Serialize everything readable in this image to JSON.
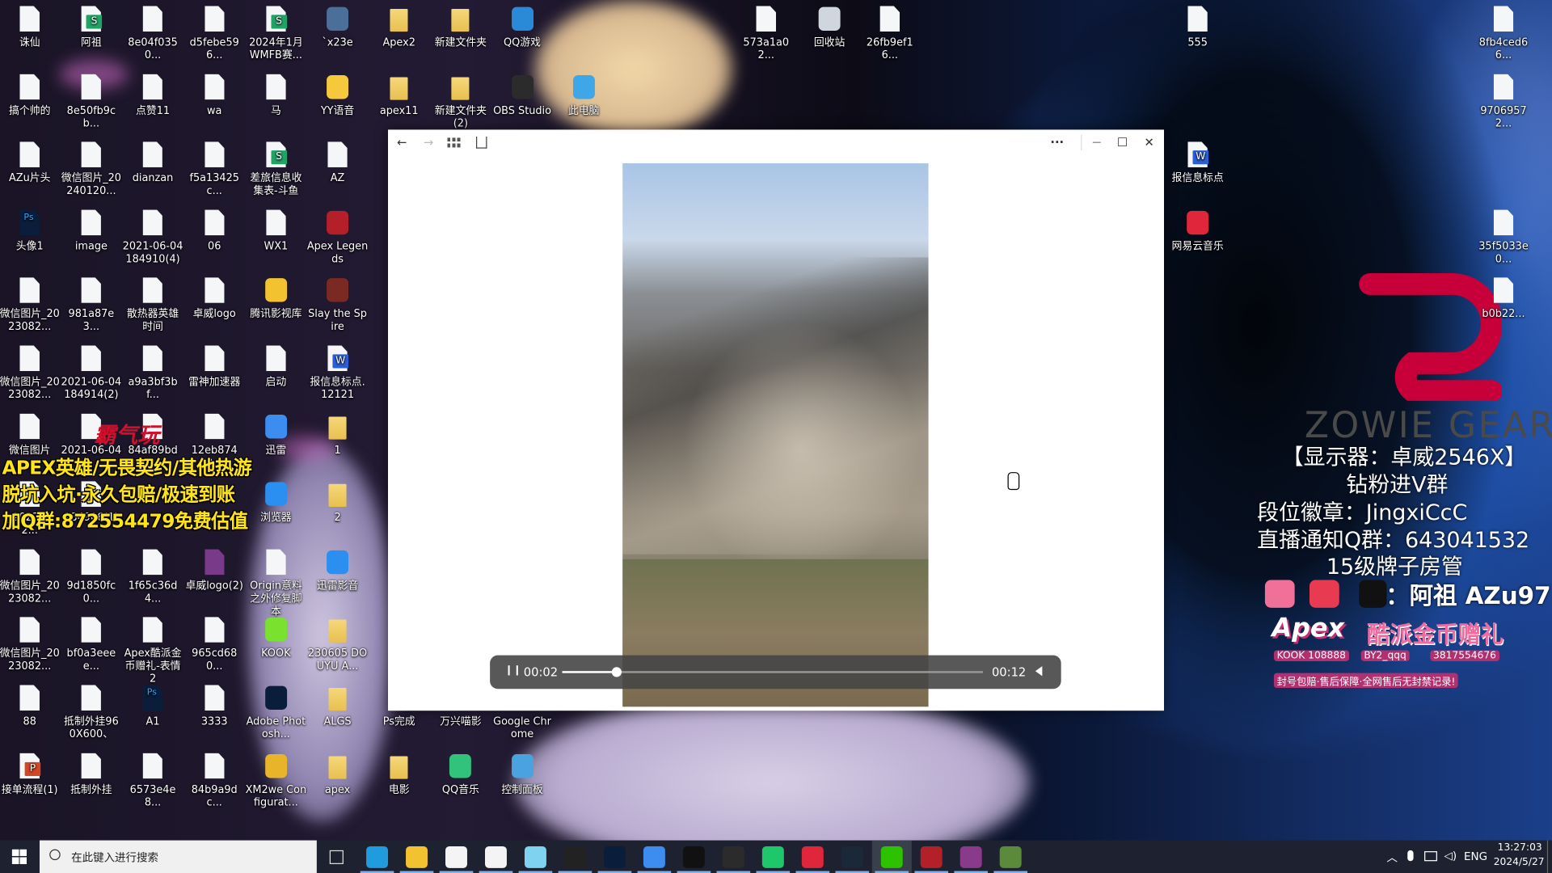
{
  "desktop_icons": [
    {
      "label": "诛仙",
      "icon": "mp4-file-icon",
      "type": "mp4"
    },
    {
      "label": "搞个帅的",
      "icon": "mp4-file-icon",
      "type": "mp4"
    },
    {
      "label": "AZu片头",
      "icon": "mp4-file-icon",
      "type": "mp4"
    },
    {
      "label": "头像1",
      "icon": "psd-file-icon",
      "type": "psd"
    },
    {
      "label": "微信图片_2023082...",
      "icon": "jpg-file-icon",
      "type": "jpg"
    },
    {
      "label": "微信图片_2023082...",
      "icon": "jpg-file-icon",
      "type": "jpg"
    },
    {
      "label": "微信图片",
      "icon": "jpg-file-icon",
      "type": "jpg"
    },
    {
      "label": "_2023082...",
      "icon": "jpg-file-icon",
      "type": "jpg"
    },
    {
      "label": "微信图片_2023082...",
      "icon": "jpg-file-icon",
      "type": "jpg"
    },
    {
      "label": "微信图片_2023082...",
      "icon": "jpg-file-icon",
      "type": "jpg"
    },
    {
      "label": "88",
      "icon": "png-file-icon",
      "type": "png"
    },
    {
      "label": "接单流程(1)",
      "icon": "ppt-file-icon",
      "type": "ppt"
    },
    {
      "label": "阿祖",
      "icon": "spreadsheet-file-icon",
      "type": "xls"
    },
    {
      "label": "8e50fb9cb...",
      "icon": "png-file-icon",
      "type": "png"
    },
    {
      "label": "微信图片_20240120...",
      "icon": "png-file-icon",
      "type": "png"
    },
    {
      "label": "image",
      "icon": "png-file-icon",
      "type": "png"
    },
    {
      "label": "981a87e3...",
      "icon": "png-file-icon",
      "type": "png"
    },
    {
      "label": "2021-06-04 184914(2)",
      "icon": "jpg-file-icon",
      "type": "jpg"
    },
    {
      "label": "2021-06-04",
      "icon": "jpg-file-icon",
      "type": "jpg"
    },
    {
      "label": "184906(1)",
      "icon": "jpg-file-icon",
      "type": "jpg"
    },
    {
      "label": "9d1850fc0...",
      "icon": "png-file-icon",
      "type": "png"
    },
    {
      "label": "bf0a3eeee...",
      "icon": "png-file-icon",
      "type": "png"
    },
    {
      "label": "抵制外挂960X600、",
      "icon": "png-file-icon",
      "type": "png"
    },
    {
      "label": "抵制外挂",
      "icon": "png-file-icon",
      "type": "png"
    },
    {
      "label": "8e04f0350...",
      "icon": "jpg-file-icon",
      "type": "jpg"
    },
    {
      "label": "点赞11",
      "icon": "png-file-icon",
      "type": "png"
    },
    {
      "label": "dianzan",
      "icon": "png-file-icon",
      "type": "png"
    },
    {
      "label": "2021-06-04 184910(4)",
      "icon": "jpg-file-icon",
      "type": "jpg"
    },
    {
      "label": "散热器英雄时间",
      "icon": "png-file-icon",
      "type": "png"
    },
    {
      "label": "a9a3bf3bf...",
      "icon": "jpg-file-icon",
      "type": "jpg"
    },
    {
      "label": "84af89bd2...",
      "icon": "jpg-file-icon",
      "type": "jpg"
    },
    {
      "label": "1f65c36d4...",
      "icon": "png-file-icon",
      "type": "png"
    },
    {
      "label": "Apex酷派金币赠礼-表情2",
      "icon": "gif-file-icon",
      "type": "gif"
    },
    {
      "label": "A1",
      "icon": "psd-file-icon",
      "type": "psd"
    },
    {
      "label": "6573e4e8...",
      "icon": "png-file-icon",
      "type": "png"
    },
    {
      "label": "d5febe596...",
      "icon": "png-file-icon",
      "type": "png"
    },
    {
      "label": "wa",
      "icon": "png-file-icon",
      "type": "png"
    },
    {
      "label": "f5a13425c...",
      "icon": "jpg-file-icon",
      "type": "jpg"
    },
    {
      "label": "06",
      "icon": "gif-file-icon",
      "type": "gif"
    },
    {
      "label": "卓威logo",
      "icon": "png-file-icon",
      "type": "png"
    },
    {
      "label": "雷神加速器",
      "icon": "png-file-icon",
      "type": "png"
    },
    {
      "label": "12eb8740...",
      "icon": "png-file-icon",
      "type": "png"
    },
    {
      "label": "卓威logo(2)",
      "icon": "rar-archive-icon",
      "type": "rar"
    },
    {
      "label": "965cd680...",
      "icon": "png-file-icon",
      "type": "png"
    },
    {
      "label": "3333",
      "icon": "png-file-icon",
      "type": "png"
    },
    {
      "label": "84b9a9dc...",
      "icon": "png-file-icon",
      "type": "png"
    },
    {
      "label": "2024年1月WMFB赛...",
      "icon": "spreadsheet-file-icon",
      "type": "xls"
    },
    {
      "label": "马",
      "icon": "jpeg-file-icon",
      "type": "jpg"
    },
    {
      "label": "差旅信息收集表-斗鱼",
      "icon": "spreadsheet-file-icon",
      "type": "xls"
    },
    {
      "label": "WX1",
      "icon": "png-file-icon",
      "type": "png"
    },
    {
      "label": "腾讯影视库",
      "icon": "tencent-video-library-icon",
      "type": "app",
      "color": "#f2c230"
    },
    {
      "label": "启动",
      "icon": "text-file-icon",
      "type": "txt"
    },
    {
      "label": "迅雷",
      "icon": "xunlei-icon",
      "type": "app",
      "color": "#3d8cf0"
    },
    {
      "label": "浏览器",
      "icon": "browser-icon",
      "type": "app",
      "color": "#2a8ff0"
    },
    {
      "label": "Origin意料之外修复脚本",
      "icon": "script-file-icon",
      "type": "txt"
    },
    {
      "label": "KOOK",
      "icon": "kook-icon",
      "type": "app",
      "color": "#7be12f"
    },
    {
      "label": "Adobe Photosh...",
      "icon": "photoshop-icon",
      "type": "app",
      "color": "#0a1d3a"
    },
    {
      "label": "XM2we Configurat...",
      "icon": "xm2we-config-icon",
      "type": "app",
      "color": "#e8b52a"
    },
    {
      "label": "`x23e",
      "icon": "x23e-app-icon",
      "type": "app",
      "color": "#4c6f9a"
    },
    {
      "label": "YY语音",
      "icon": "yy-voice-icon",
      "type": "app",
      "color": "#f5c93b"
    },
    {
      "label": "AZ",
      "icon": "text-file-icon",
      "type": "txt"
    },
    {
      "label": "Apex Legends",
      "icon": "apex-legends-icon",
      "type": "app",
      "color": "#b3202a"
    },
    {
      "label": "Slay the Spire",
      "icon": "slay-the-spire-icon",
      "type": "app",
      "color": "#7a2a22"
    },
    {
      "label": "报信息标点.12121",
      "icon": "word-file-icon",
      "type": "doc"
    },
    {
      "label": "1",
      "icon": "folder-icon",
      "type": "folder"
    },
    {
      "label": "2",
      "icon": "folder-icon",
      "type": "folder"
    },
    {
      "label": "迅雷影音",
      "icon": "xunlei-player-icon",
      "type": "app",
      "color": "#2a8ff0"
    },
    {
      "label": "230605 DOUYU A...",
      "icon": "folder-icon",
      "type": "folder"
    },
    {
      "label": "ALGS",
      "icon": "folder-icon",
      "type": "folder"
    },
    {
      "label": "apex",
      "icon": "folder-icon",
      "type": "folder"
    },
    {
      "label": "Apex2",
      "icon": "folder-icon",
      "type": "folder"
    },
    {
      "label": "apex11",
      "icon": "folder-icon",
      "type": "folder"
    },
    {
      "label": "Ps完成",
      "icon": "folder-icon",
      "type": "folder"
    },
    {
      "label": "电影",
      "icon": "folder-icon",
      "type": "folder"
    },
    {
      "label": "新建文件夹",
      "icon": "folder-icon",
      "type": "folder"
    },
    {
      "label": "新建文件夹 (2)",
      "icon": "folder-icon",
      "type": "folder"
    },
    {
      "label": "万兴喵影",
      "icon": "wondershare-filmora-icon",
      "type": "app",
      "color": "#1d9ad6"
    },
    {
      "label": "QQ音乐",
      "icon": "qq-music-icon",
      "type": "app",
      "color": "#31c27c"
    },
    {
      "label": "QQ游戏",
      "icon": "qq-game-icon",
      "type": "app",
      "color": "#2b8ad8"
    },
    {
      "label": "OBS Studio",
      "icon": "obs-studio-icon",
      "type": "app",
      "color": "#2b2b2b"
    },
    {
      "label": "Google Chrome",
      "icon": "chrome-icon",
      "type": "app",
      "color": "#dd4b3e"
    },
    {
      "label": "控制面板",
      "icon": "control-panel-icon",
      "type": "app",
      "color": "#4aa3df"
    },
    {
      "label": "此电脑",
      "icon": "this-pc-icon",
      "type": "app",
      "color": "#3fa7e8"
    },
    {
      "label": "573a1a02...",
      "icon": "png-file-icon",
      "type": "png"
    },
    {
      "label": "回收站",
      "icon": "recycle-bin-icon",
      "type": "app",
      "color": "#cfd6de"
    },
    {
      "label": "26fb9ef16...",
      "icon": "png-file-icon",
      "type": "png"
    },
    {
      "label": "555",
      "icon": "png-file-icon",
      "type": "png"
    },
    {
      "label": "报信息标点",
      "icon": "word-file-icon",
      "type": "doc"
    },
    {
      "label": "网易云音乐",
      "icon": "netease-music-icon",
      "type": "app",
      "color": "#e0263a"
    },
    {
      "label": "8fb4ced66...",
      "icon": "png-file-icon",
      "type": "png"
    },
    {
      "label": "97069572...",
      "icon": "png-file-icon",
      "type": "png"
    },
    {
      "label": "35f5033e0...",
      "icon": "png-file-icon",
      "type": "png"
    },
    {
      "label": "b0b22...",
      "icon": "png-file-icon",
      "type": "png"
    }
  ],
  "wallpaper_overlay": {
    "left_ad": {
      "stamp": "霸气玩",
      "lines": [
        "APEX英雄/无畏契约/其他热游",
        "脱坑入坑·永久包赔/极速到账",
        "加Q群:872554479免费估值"
      ]
    },
    "zowie_logo_text": "ZOWIE GEAR",
    "right_info": [
      "【显示器：卓威2546X】",
      "钻粉进V群",
      "段位徽章：JingxiCcC",
      "直播通知Q群：643041532",
      "15级牌子房管"
    ],
    "socials_label": "：阿祖 AZu97",
    "banner": {
      "title_latin": "Apex",
      "title_cn": "酷派金币赠礼",
      "kook": "108888",
      "wechat": "BY2_qqq",
      "qq": "3817554676",
      "footer": "封号包赔·售后保障·全网售后无封禁记录!"
    }
  },
  "viewer_window": {
    "toolbar": {
      "back": "←",
      "forward": "→",
      "gallery": "gallery-icon",
      "save": "save-icon",
      "more": "···",
      "minimize": "—",
      "maximize": "☐",
      "close": "✕"
    },
    "player": {
      "state": "playing",
      "current_time": "00:02",
      "duration": "00:12",
      "progress": 0.13,
      "pause_glyph": "❙❙",
      "volume_glyph": "🔈"
    }
  },
  "taskbar": {
    "search_placeholder": "在此键入进行搜索",
    "apps": [
      {
        "name": "edge",
        "color": "#1f9bde"
      },
      {
        "name": "file-explorer",
        "color": "#f2c230"
      },
      {
        "name": "microsoft-store",
        "color": "#f4f4f4"
      },
      {
        "name": "mail",
        "color": "#f4f4f4"
      },
      {
        "name": "bilibili-live",
        "color": "#7fd3f0"
      },
      {
        "name": "tiktok",
        "color": "#222"
      },
      {
        "name": "photoshop",
        "color": "#0a1d3a"
      },
      {
        "name": "xunlei",
        "color": "#3d8cf0"
      },
      {
        "name": "oopz",
        "color": "#111"
      },
      {
        "name": "obs-studio",
        "color": "#2b2b2b"
      },
      {
        "name": "razer-synapse",
        "color": "#1ec76a"
      },
      {
        "name": "netease-music",
        "color": "#e0263a"
      },
      {
        "name": "steam",
        "color": "#1b2838"
      },
      {
        "name": "wechat",
        "color": "#2dc100",
        "active": true
      },
      {
        "name": "apex-legends",
        "color": "#b3202a"
      },
      {
        "name": "winrar",
        "color": "#8a3a8a"
      },
      {
        "name": "game-app",
        "color": "#5a8a3a"
      }
    ],
    "tray": {
      "language": "ENG",
      "time": "13:27:03",
      "date": "2024/5/27"
    }
  }
}
